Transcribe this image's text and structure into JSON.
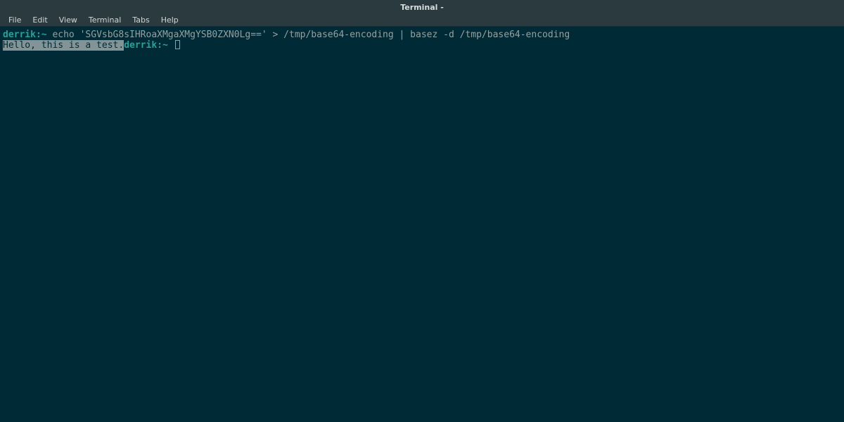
{
  "window": {
    "title": "Terminal -"
  },
  "menubar": {
    "items": [
      "File",
      "Edit",
      "View",
      "Terminal",
      "Tabs",
      "Help"
    ]
  },
  "terminal": {
    "line1": {
      "prompt": "derrik:~",
      "command": " echo 'SGVsbG8sIHRoaXMgaXMgYSB0ZXN0Lg==' > /tmp/base64-encoding | basez -d /tmp/base64-encoding"
    },
    "line2": {
      "output": "Hello, this is a test.",
      "prompt": "derrik:~"
    }
  }
}
